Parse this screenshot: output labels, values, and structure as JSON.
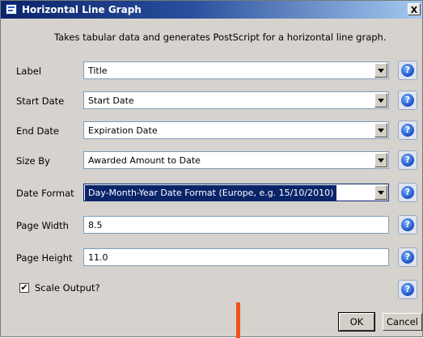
{
  "window": {
    "title": "Horizontal Line Graph",
    "close_glyph": "X"
  },
  "description": "Takes tabular data and generates PostScript for a horizontal line graph.",
  "fields": [
    {
      "label": "Label",
      "value": "Title",
      "type": "dropdown"
    },
    {
      "label": "Start Date",
      "value": "Start Date",
      "type": "dropdown"
    },
    {
      "label": "End Date",
      "value": "Expiration Date",
      "type": "dropdown"
    },
    {
      "label": "Size By",
      "value": "Awarded Amount to Date",
      "type": "dropdown"
    },
    {
      "label": "Date Format",
      "value": "Day-Month-Year Date Format (Europe, e.g. 15/10/2010)",
      "type": "dropdown",
      "selected": true
    },
    {
      "label": "Page Width",
      "value": "8.5",
      "type": "text"
    },
    {
      "label": "Page Height",
      "value": "11.0",
      "type": "text"
    }
  ],
  "scale_output": {
    "label": "Scale Output?",
    "checked": true,
    "check_glyph": "✔"
  },
  "help_glyph": "?",
  "buttons": {
    "ok": "OK",
    "cancel": "Cancel"
  },
  "colors": {
    "accent": "#0a246a",
    "help_icon": "#1a4fc4",
    "marker": "#f0501a"
  }
}
